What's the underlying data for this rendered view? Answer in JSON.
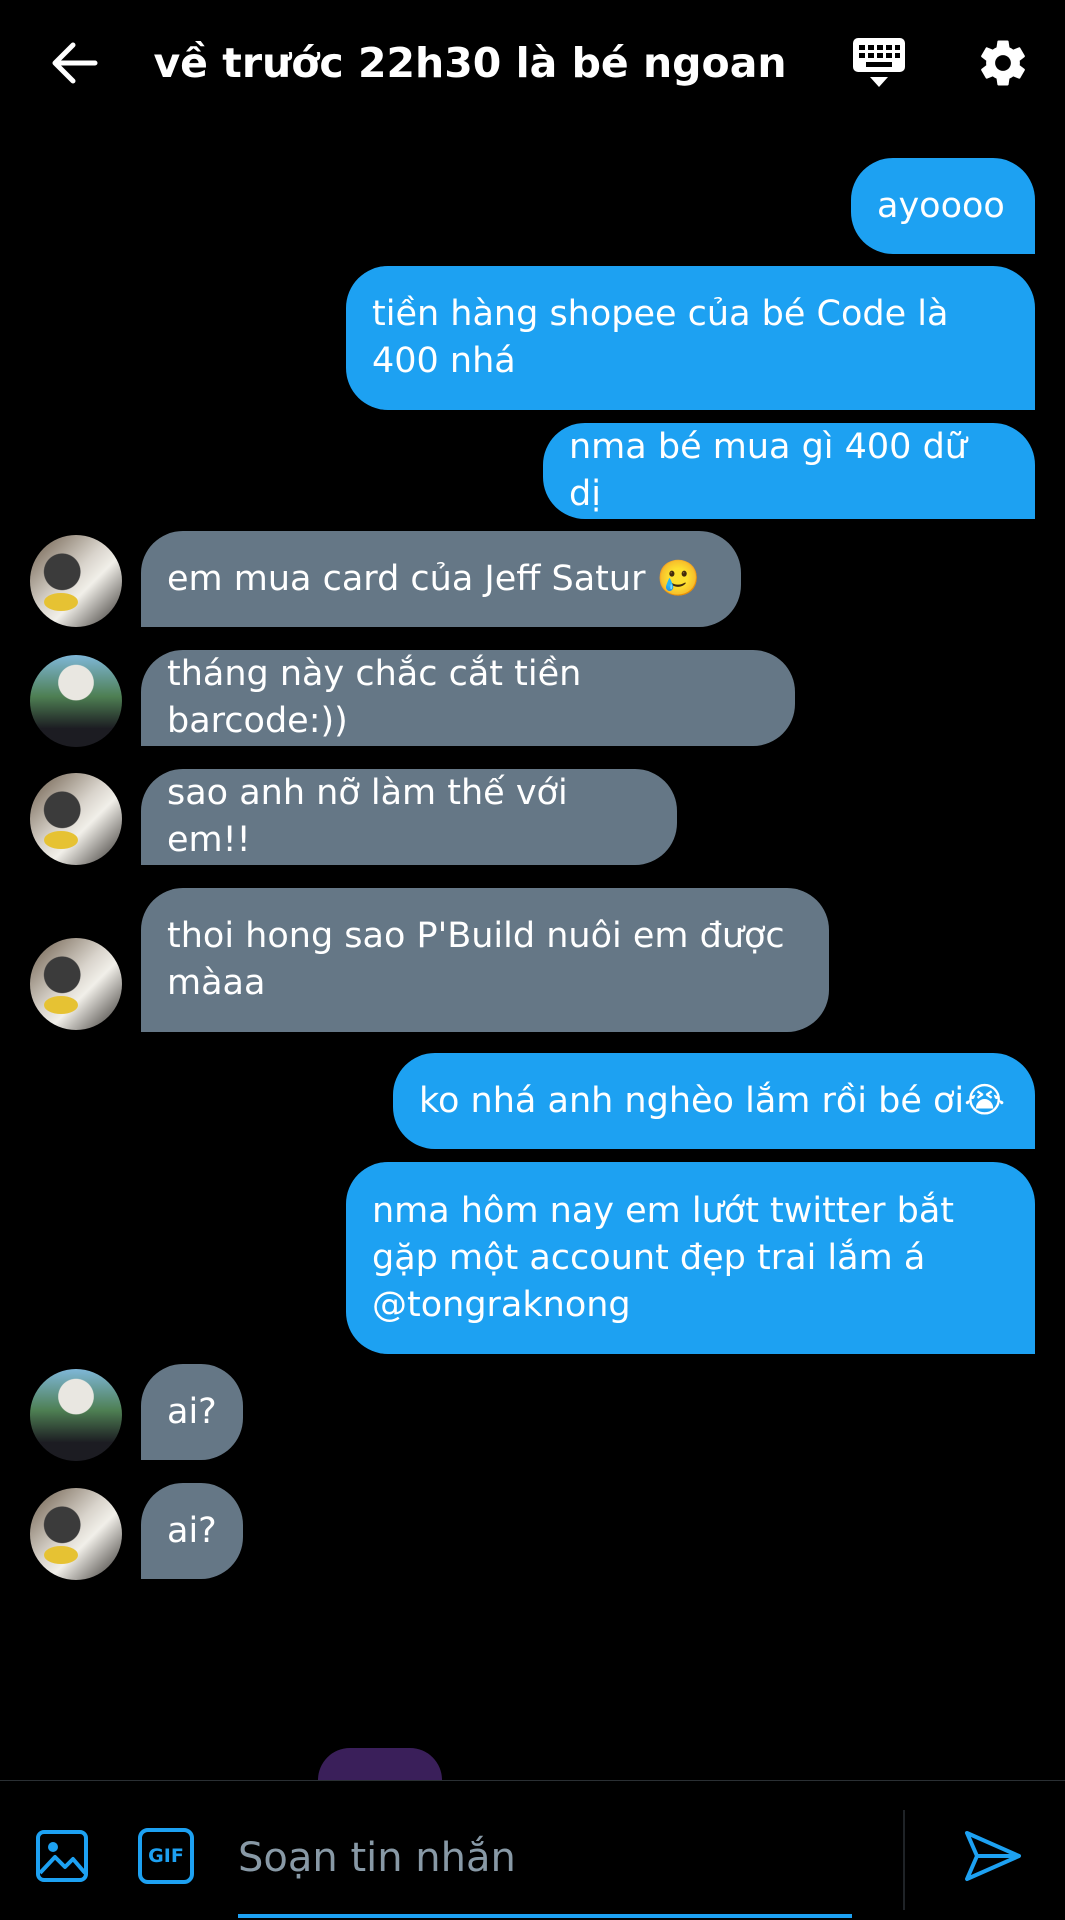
{
  "header": {
    "title": "về trước 22h30 là bé ngoan",
    "back_icon": "arrow-left-icon",
    "keyboard_icon": "keyboard-icon",
    "settings_icon": "gear-icon"
  },
  "messages": [
    {
      "side": "sent",
      "text": "ayoooo"
    },
    {
      "side": "sent",
      "text": "tiền hàng shopee của bé Code là 400 nhá"
    },
    {
      "side": "sent",
      "text": "nma bé mua gì 400 dữ dị"
    },
    {
      "side": "received",
      "avatar": "a",
      "text": "em mua card của Jeff Satur 🥲"
    },
    {
      "side": "received",
      "avatar": "b",
      "text": "tháng này chắc cắt tiền barcode:))"
    },
    {
      "side": "received",
      "avatar": "a",
      "text": "sao anh nỡ làm thế với em!!"
    },
    {
      "side": "received",
      "avatar": "a",
      "text": "thoi hong sao P'Build nuôi em được màaa"
    },
    {
      "side": "sent",
      "text": "ko nhá anh nghèo lắm rồi bé ơi😭"
    },
    {
      "side": "sent",
      "text": "nma hôm nay em lướt twitter bắt gặp một account đẹp trai lắm á @tongraknong"
    },
    {
      "side": "received",
      "avatar": "b",
      "text": "ai?"
    },
    {
      "side": "received",
      "avatar": "a",
      "text": "ai?"
    }
  ],
  "composer": {
    "placeholder": "Soạn tin nhắn",
    "gif_label": "GIF",
    "image_icon": "image-icon",
    "send_icon": "send-icon"
  },
  "colors": {
    "background": "#000000",
    "sent_bubble": "#1DA1F2",
    "received_bubble": "#657786",
    "accent": "#1DA1F2"
  }
}
